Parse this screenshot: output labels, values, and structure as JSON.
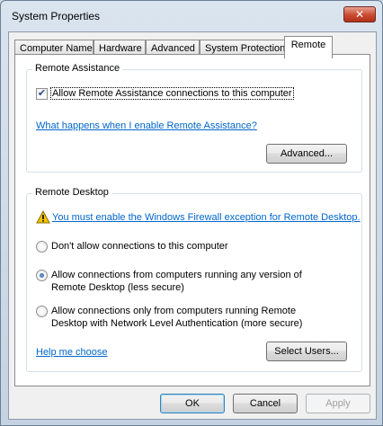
{
  "window": {
    "title": "System Properties",
    "close_glyph": "✕"
  },
  "tabs": [
    {
      "label": "Computer Name"
    },
    {
      "label": "Hardware"
    },
    {
      "label": "Advanced"
    },
    {
      "label": "System Protection"
    },
    {
      "label": "Remote",
      "active": true
    }
  ],
  "remote_assistance": {
    "group_label": "Remote Assistance",
    "allow_checkbox_label": "Allow Remote Assistance connections to this computer",
    "allow_checked": true,
    "help_link": "What happens when I enable Remote Assistance?",
    "advanced_button": "Advanced..."
  },
  "remote_desktop": {
    "group_label": "Remote Desktop",
    "warning_icon": "warning-triangle-icon",
    "warning_link": "You must enable the Windows Firewall exception for Remote Desktop.",
    "options": [
      {
        "line1": "Don't allow connections to this computer",
        "line2": "",
        "checked": false
      },
      {
        "line1": "Allow connections from computers running any version of",
        "line2": "Remote Desktop (less secure)",
        "checked": true
      },
      {
        "line1": "Allow connections only from computers running Remote",
        "line2": "Desktop with Network Level Authentication (more secure)",
        "checked": false
      }
    ],
    "help_link": "Help me choose",
    "select_users_button": "Select Users..."
  },
  "footer": {
    "ok": "OK",
    "cancel": "Cancel",
    "apply": "Apply",
    "apply_enabled": false
  },
  "colors": {
    "link": "#0066cc",
    "close_button": "#c94a2f",
    "warning_fill": "#f5c400"
  }
}
